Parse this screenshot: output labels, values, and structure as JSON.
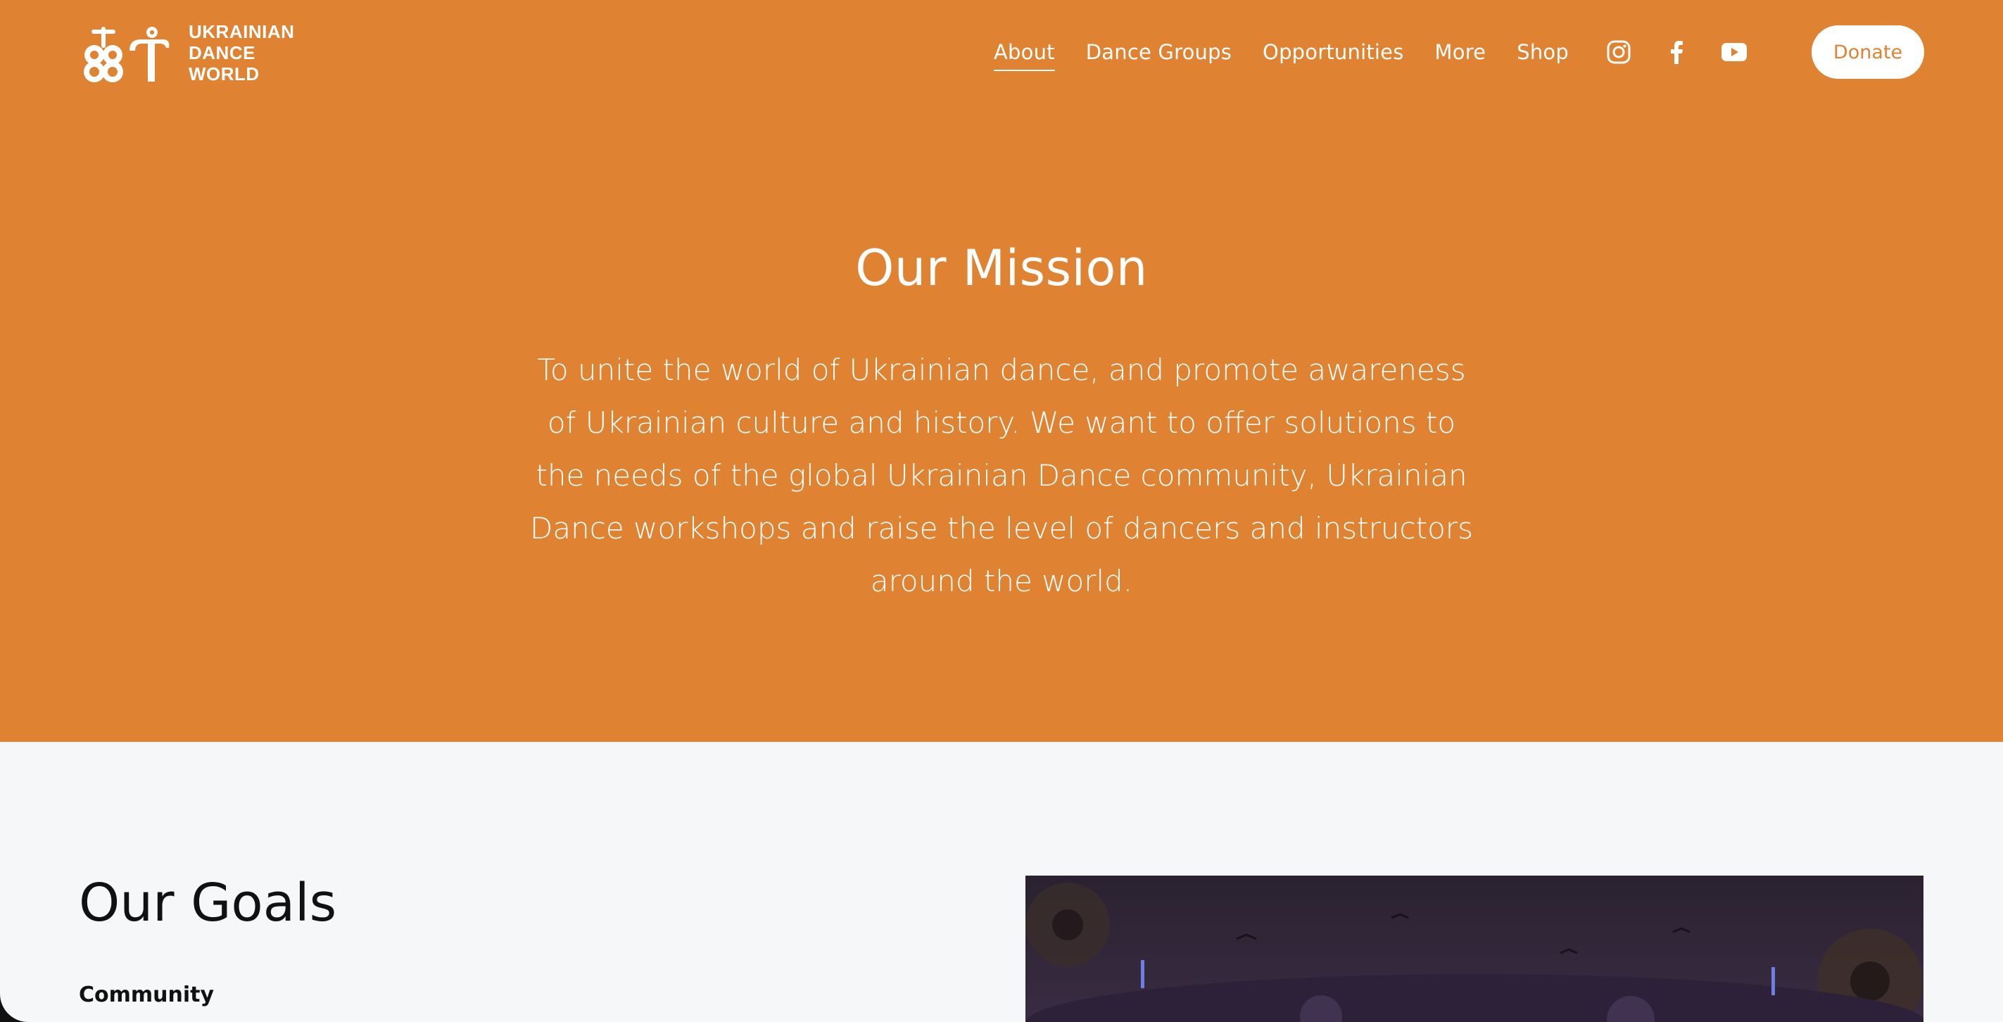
{
  "brand": {
    "logo_lines": [
      "UKRAINIAN",
      "DANCE",
      "WORLD"
    ],
    "logo_icon": "udw-logo-mark",
    "primary_color": "#df8231",
    "text_color": "#ffffff"
  },
  "nav": {
    "items": [
      {
        "label": "About",
        "active": true
      },
      {
        "label": "Dance Groups",
        "active": false
      },
      {
        "label": "Opportunities",
        "active": false
      },
      {
        "label": "More",
        "active": false
      },
      {
        "label": "Shop",
        "active": false
      }
    ]
  },
  "social": {
    "icons": [
      "instagram-icon",
      "facebook-icon",
      "youtube-icon"
    ]
  },
  "header": {
    "donate_label": "Donate"
  },
  "mission": {
    "title": "Our Mission",
    "body": "To unite the world of Ukrainian dance, and promote awareness of Ukrainian culture and history. We want to offer solutions to the needs of the global Ukrainian Dance community, Ukrainian Dance workshops and raise the level of dancers and instructors around the world."
  },
  "goals": {
    "title": "Our Goals",
    "first_subheading": "Community",
    "image_bg_color": "#1d1623"
  }
}
